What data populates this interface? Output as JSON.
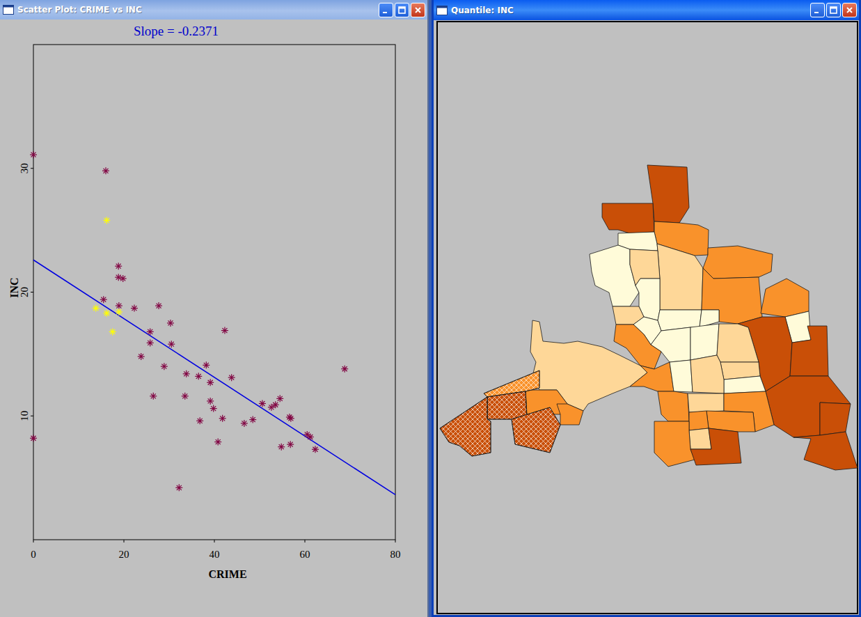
{
  "scatter_window": {
    "title": "Scatter Plot: CRIME vs INC",
    "chart": {
      "title": "Slope = -0.2371",
      "x_label": "CRIME",
      "y_label": "INC",
      "x_ticks": [
        "0",
        "20",
        "40",
        "60",
        "80"
      ],
      "y_ticks": [
        "10",
        "20",
        "30"
      ],
      "x_range": [
        0,
        80
      ],
      "y_range": [
        0,
        40
      ],
      "regression": {
        "intercept": 22.6,
        "slope": -0.2371
      },
      "points": [
        {
          "x": 0,
          "y": 31.1,
          "selected": false
        },
        {
          "x": 0,
          "y": 8.2,
          "selected": false
        },
        {
          "x": 16.0,
          "y": 29.8,
          "selected": false
        },
        {
          "x": 18.8,
          "y": 22.1,
          "selected": false
        },
        {
          "x": 18.8,
          "y": 21.2,
          "selected": false
        },
        {
          "x": 19.8,
          "y": 21.1,
          "selected": false
        },
        {
          "x": 15.5,
          "y": 19.4,
          "selected": false
        },
        {
          "x": 18.9,
          "y": 18.9,
          "selected": false
        },
        {
          "x": 22.3,
          "y": 18.7,
          "selected": false
        },
        {
          "x": 27.7,
          "y": 18.9,
          "selected": false
        },
        {
          "x": 30.3,
          "y": 17.5,
          "selected": false
        },
        {
          "x": 25.8,
          "y": 16.8,
          "selected": false
        },
        {
          "x": 25.8,
          "y": 15.9,
          "selected": false
        },
        {
          "x": 30.5,
          "y": 15.8,
          "selected": false
        },
        {
          "x": 42.3,
          "y": 16.9,
          "selected": false
        },
        {
          "x": 23.8,
          "y": 14.8,
          "selected": false
        },
        {
          "x": 28.9,
          "y": 14.0,
          "selected": false
        },
        {
          "x": 38.2,
          "y": 14.1,
          "selected": false
        },
        {
          "x": 33.8,
          "y": 13.4,
          "selected": false
        },
        {
          "x": 36.5,
          "y": 13.2,
          "selected": false
        },
        {
          "x": 43.8,
          "y": 13.1,
          "selected": false
        },
        {
          "x": 39.1,
          "y": 12.7,
          "selected": false
        },
        {
          "x": 26.5,
          "y": 11.6,
          "selected": false
        },
        {
          "x": 33.5,
          "y": 11.6,
          "selected": false
        },
        {
          "x": 39.1,
          "y": 11.2,
          "selected": false
        },
        {
          "x": 39.8,
          "y": 10.6,
          "selected": false
        },
        {
          "x": 50.6,
          "y": 11.0,
          "selected": false
        },
        {
          "x": 52.6,
          "y": 10.7,
          "selected": false
        },
        {
          "x": 53.5,
          "y": 10.9,
          "selected": false
        },
        {
          "x": 54.5,
          "y": 11.4,
          "selected": false
        },
        {
          "x": 56.6,
          "y": 9.9,
          "selected": false
        },
        {
          "x": 56.9,
          "y": 9.8,
          "selected": false
        },
        {
          "x": 48.5,
          "y": 9.7,
          "selected": false
        },
        {
          "x": 46.6,
          "y": 9.4,
          "selected": false
        },
        {
          "x": 41.8,
          "y": 9.8,
          "selected": false
        },
        {
          "x": 36.8,
          "y": 9.6,
          "selected": false
        },
        {
          "x": 40.8,
          "y": 7.9,
          "selected": false
        },
        {
          "x": 54.8,
          "y": 7.5,
          "selected": false
        },
        {
          "x": 56.8,
          "y": 7.7,
          "selected": false
        },
        {
          "x": 60.5,
          "y": 8.5,
          "selected": false
        },
        {
          "x": 61.2,
          "y": 8.3,
          "selected": false
        },
        {
          "x": 62.3,
          "y": 7.3,
          "selected": false
        },
        {
          "x": 68.8,
          "y": 13.8,
          "selected": false
        },
        {
          "x": 32.2,
          "y": 4.2,
          "selected": false
        },
        {
          "x": 16.2,
          "y": 25.8,
          "selected": true
        },
        {
          "x": 13.8,
          "y": 18.7,
          "selected": true
        },
        {
          "x": 16.2,
          "y": 18.3,
          "selected": true
        },
        {
          "x": 18.9,
          "y": 18.4,
          "selected": true
        },
        {
          "x": 17.5,
          "y": 16.8,
          "selected": true
        }
      ]
    }
  },
  "map_window": {
    "title": "Quantile: INC",
    "map": {
      "regions": [
        {
          "color": "#c94f07",
          "selected": false
        },
        {
          "color": "#c94f07",
          "selected": false
        },
        {
          "color": "#f9922b",
          "selected": false
        },
        {
          "color": "#fffbd9",
          "selected": false
        },
        {
          "color": "#fed798",
          "selected": false
        },
        {
          "color": "#f9922b",
          "selected": false
        },
        {
          "color": "#f9922b",
          "selected": false
        },
        {
          "color": "#f9922b",
          "selected": false
        },
        {
          "color": "#fffbd9",
          "selected": false
        },
        {
          "color": "#c94f07",
          "selected": false
        },
        {
          "color": "#c94f07",
          "selected": false
        },
        {
          "color": "#c94f07",
          "selected": false
        },
        {
          "color": "#c94f07",
          "selected": false
        },
        {
          "color": "#c94f07",
          "selected": false
        },
        {
          "color": "#fffbd9",
          "selected": false
        },
        {
          "color": "#fed798",
          "selected": false
        },
        {
          "color": "#fffbd9",
          "selected": false
        },
        {
          "color": "#fed798",
          "selected": false
        },
        {
          "color": "#fffbd9",
          "selected": false
        },
        {
          "color": "#fffbd9",
          "selected": false
        },
        {
          "color": "#fffbd9",
          "selected": false
        },
        {
          "color": "#fffbd9",
          "selected": false
        },
        {
          "color": "#fffbd9",
          "selected": false
        },
        {
          "color": "#fed798",
          "selected": false
        },
        {
          "color": "#fed798",
          "selected": false
        },
        {
          "color": "#fffbd9",
          "selected": false
        },
        {
          "color": "#f9922b",
          "selected": false
        },
        {
          "color": "#fed798",
          "selected": false
        },
        {
          "color": "#f9922b",
          "selected": false
        },
        {
          "color": "#fffbd9",
          "selected": false
        },
        {
          "color": "#fed798",
          "selected": false
        },
        {
          "color": "#f9922b",
          "selected": false
        },
        {
          "color": "#fed798",
          "selected": false
        },
        {
          "color": "#f9922b",
          "selected": false
        },
        {
          "color": "#f9922b",
          "selected": false
        },
        {
          "color": "#f9922b",
          "selected": false
        },
        {
          "color": "#fed798",
          "selected": false
        },
        {
          "color": "#f9922b",
          "selected": false
        },
        {
          "color": "#c94f07",
          "selected": false
        },
        {
          "color": "#f9922b",
          "selected": false
        },
        {
          "color": "#f9922b",
          "selected": false
        },
        {
          "color": "#f9922b",
          "selected": true
        },
        {
          "color": "#c94f07",
          "selected": true
        },
        {
          "color": "#c94f07",
          "selected": true
        },
        {
          "color": "#c94f07",
          "selected": true
        }
      ]
    }
  }
}
